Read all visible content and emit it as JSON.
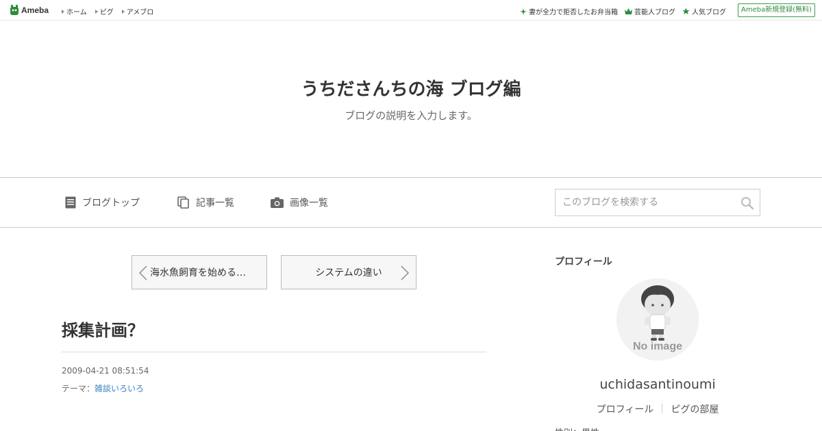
{
  "topbar": {
    "logo_text": "Ameba",
    "nav": [
      "ホーム",
      "ピグ",
      "アメブロ"
    ],
    "right_links": [
      {
        "icon": "sparkle-icon",
        "label": "妻が全力で拒否したお弁当箱"
      },
      {
        "icon": "crown-icon",
        "label": "芸能人ブログ"
      },
      {
        "icon": "star-icon",
        "label": "人気ブログ"
      }
    ],
    "register_label": "Ameba新規登録(無料)"
  },
  "header": {
    "title": "うちださんちの海 ブログ編",
    "description": "ブログの説明を入力します。"
  },
  "nav": {
    "items": [
      "ブログトップ",
      "記事一覧",
      "画像一覧"
    ],
    "search_placeholder": "このブログを検索する"
  },
  "pager": {
    "prev_label": "海水魚飼育を始める…",
    "next_label": "システムの違い"
  },
  "entry": {
    "title": "採集計画？",
    "date": "2009-04-21 08:51:54",
    "theme_prefix": "テーマ：",
    "theme_link": "雑談いろいろ"
  },
  "sidebar": {
    "heading": "プロフィール",
    "avatar_text": "No image",
    "name": "uchidasantinoumi",
    "links": [
      "プロフィール",
      "ピグの部屋"
    ],
    "cut_text": "性別：男性"
  },
  "colors": {
    "accent_green": "#2d8c3c",
    "link_blue": "#3b7fc4"
  }
}
